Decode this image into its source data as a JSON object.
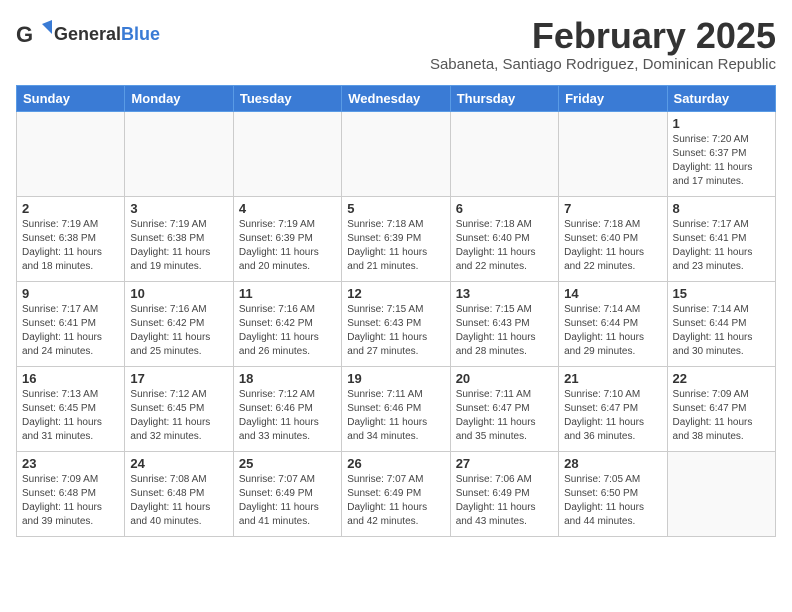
{
  "logo": {
    "general": "General",
    "blue": "Blue"
  },
  "title": "February 2025",
  "location": "Sabaneta, Santiago Rodriguez, Dominican Republic",
  "days_of_week": [
    "Sunday",
    "Monday",
    "Tuesday",
    "Wednesday",
    "Thursday",
    "Friday",
    "Saturday"
  ],
  "weeks": [
    [
      {
        "day": "",
        "info": ""
      },
      {
        "day": "",
        "info": ""
      },
      {
        "day": "",
        "info": ""
      },
      {
        "day": "",
        "info": ""
      },
      {
        "day": "",
        "info": ""
      },
      {
        "day": "",
        "info": ""
      },
      {
        "day": "1",
        "info": "Sunrise: 7:20 AM\nSunset: 6:37 PM\nDaylight: 11 hours and 17 minutes."
      }
    ],
    [
      {
        "day": "2",
        "info": "Sunrise: 7:19 AM\nSunset: 6:38 PM\nDaylight: 11 hours and 18 minutes."
      },
      {
        "day": "3",
        "info": "Sunrise: 7:19 AM\nSunset: 6:38 PM\nDaylight: 11 hours and 19 minutes."
      },
      {
        "day": "4",
        "info": "Sunrise: 7:19 AM\nSunset: 6:39 PM\nDaylight: 11 hours and 20 minutes."
      },
      {
        "day": "5",
        "info": "Sunrise: 7:18 AM\nSunset: 6:39 PM\nDaylight: 11 hours and 21 minutes."
      },
      {
        "day": "6",
        "info": "Sunrise: 7:18 AM\nSunset: 6:40 PM\nDaylight: 11 hours and 22 minutes."
      },
      {
        "day": "7",
        "info": "Sunrise: 7:18 AM\nSunset: 6:40 PM\nDaylight: 11 hours and 22 minutes."
      },
      {
        "day": "8",
        "info": "Sunrise: 7:17 AM\nSunset: 6:41 PM\nDaylight: 11 hours and 23 minutes."
      }
    ],
    [
      {
        "day": "9",
        "info": "Sunrise: 7:17 AM\nSunset: 6:41 PM\nDaylight: 11 hours and 24 minutes."
      },
      {
        "day": "10",
        "info": "Sunrise: 7:16 AM\nSunset: 6:42 PM\nDaylight: 11 hours and 25 minutes."
      },
      {
        "day": "11",
        "info": "Sunrise: 7:16 AM\nSunset: 6:42 PM\nDaylight: 11 hours and 26 minutes."
      },
      {
        "day": "12",
        "info": "Sunrise: 7:15 AM\nSunset: 6:43 PM\nDaylight: 11 hours and 27 minutes."
      },
      {
        "day": "13",
        "info": "Sunrise: 7:15 AM\nSunset: 6:43 PM\nDaylight: 11 hours and 28 minutes."
      },
      {
        "day": "14",
        "info": "Sunrise: 7:14 AM\nSunset: 6:44 PM\nDaylight: 11 hours and 29 minutes."
      },
      {
        "day": "15",
        "info": "Sunrise: 7:14 AM\nSunset: 6:44 PM\nDaylight: 11 hours and 30 minutes."
      }
    ],
    [
      {
        "day": "16",
        "info": "Sunrise: 7:13 AM\nSunset: 6:45 PM\nDaylight: 11 hours and 31 minutes."
      },
      {
        "day": "17",
        "info": "Sunrise: 7:12 AM\nSunset: 6:45 PM\nDaylight: 11 hours and 32 minutes."
      },
      {
        "day": "18",
        "info": "Sunrise: 7:12 AM\nSunset: 6:46 PM\nDaylight: 11 hours and 33 minutes."
      },
      {
        "day": "19",
        "info": "Sunrise: 7:11 AM\nSunset: 6:46 PM\nDaylight: 11 hours and 34 minutes."
      },
      {
        "day": "20",
        "info": "Sunrise: 7:11 AM\nSunset: 6:47 PM\nDaylight: 11 hours and 35 minutes."
      },
      {
        "day": "21",
        "info": "Sunrise: 7:10 AM\nSunset: 6:47 PM\nDaylight: 11 hours and 36 minutes."
      },
      {
        "day": "22",
        "info": "Sunrise: 7:09 AM\nSunset: 6:47 PM\nDaylight: 11 hours and 38 minutes."
      }
    ],
    [
      {
        "day": "23",
        "info": "Sunrise: 7:09 AM\nSunset: 6:48 PM\nDaylight: 11 hours and 39 minutes."
      },
      {
        "day": "24",
        "info": "Sunrise: 7:08 AM\nSunset: 6:48 PM\nDaylight: 11 hours and 40 minutes."
      },
      {
        "day": "25",
        "info": "Sunrise: 7:07 AM\nSunset: 6:49 PM\nDaylight: 11 hours and 41 minutes."
      },
      {
        "day": "26",
        "info": "Sunrise: 7:07 AM\nSunset: 6:49 PM\nDaylight: 11 hours and 42 minutes."
      },
      {
        "day": "27",
        "info": "Sunrise: 7:06 AM\nSunset: 6:49 PM\nDaylight: 11 hours and 43 minutes."
      },
      {
        "day": "28",
        "info": "Sunrise: 7:05 AM\nSunset: 6:50 PM\nDaylight: 11 hours and 44 minutes."
      },
      {
        "day": "",
        "info": ""
      }
    ]
  ]
}
